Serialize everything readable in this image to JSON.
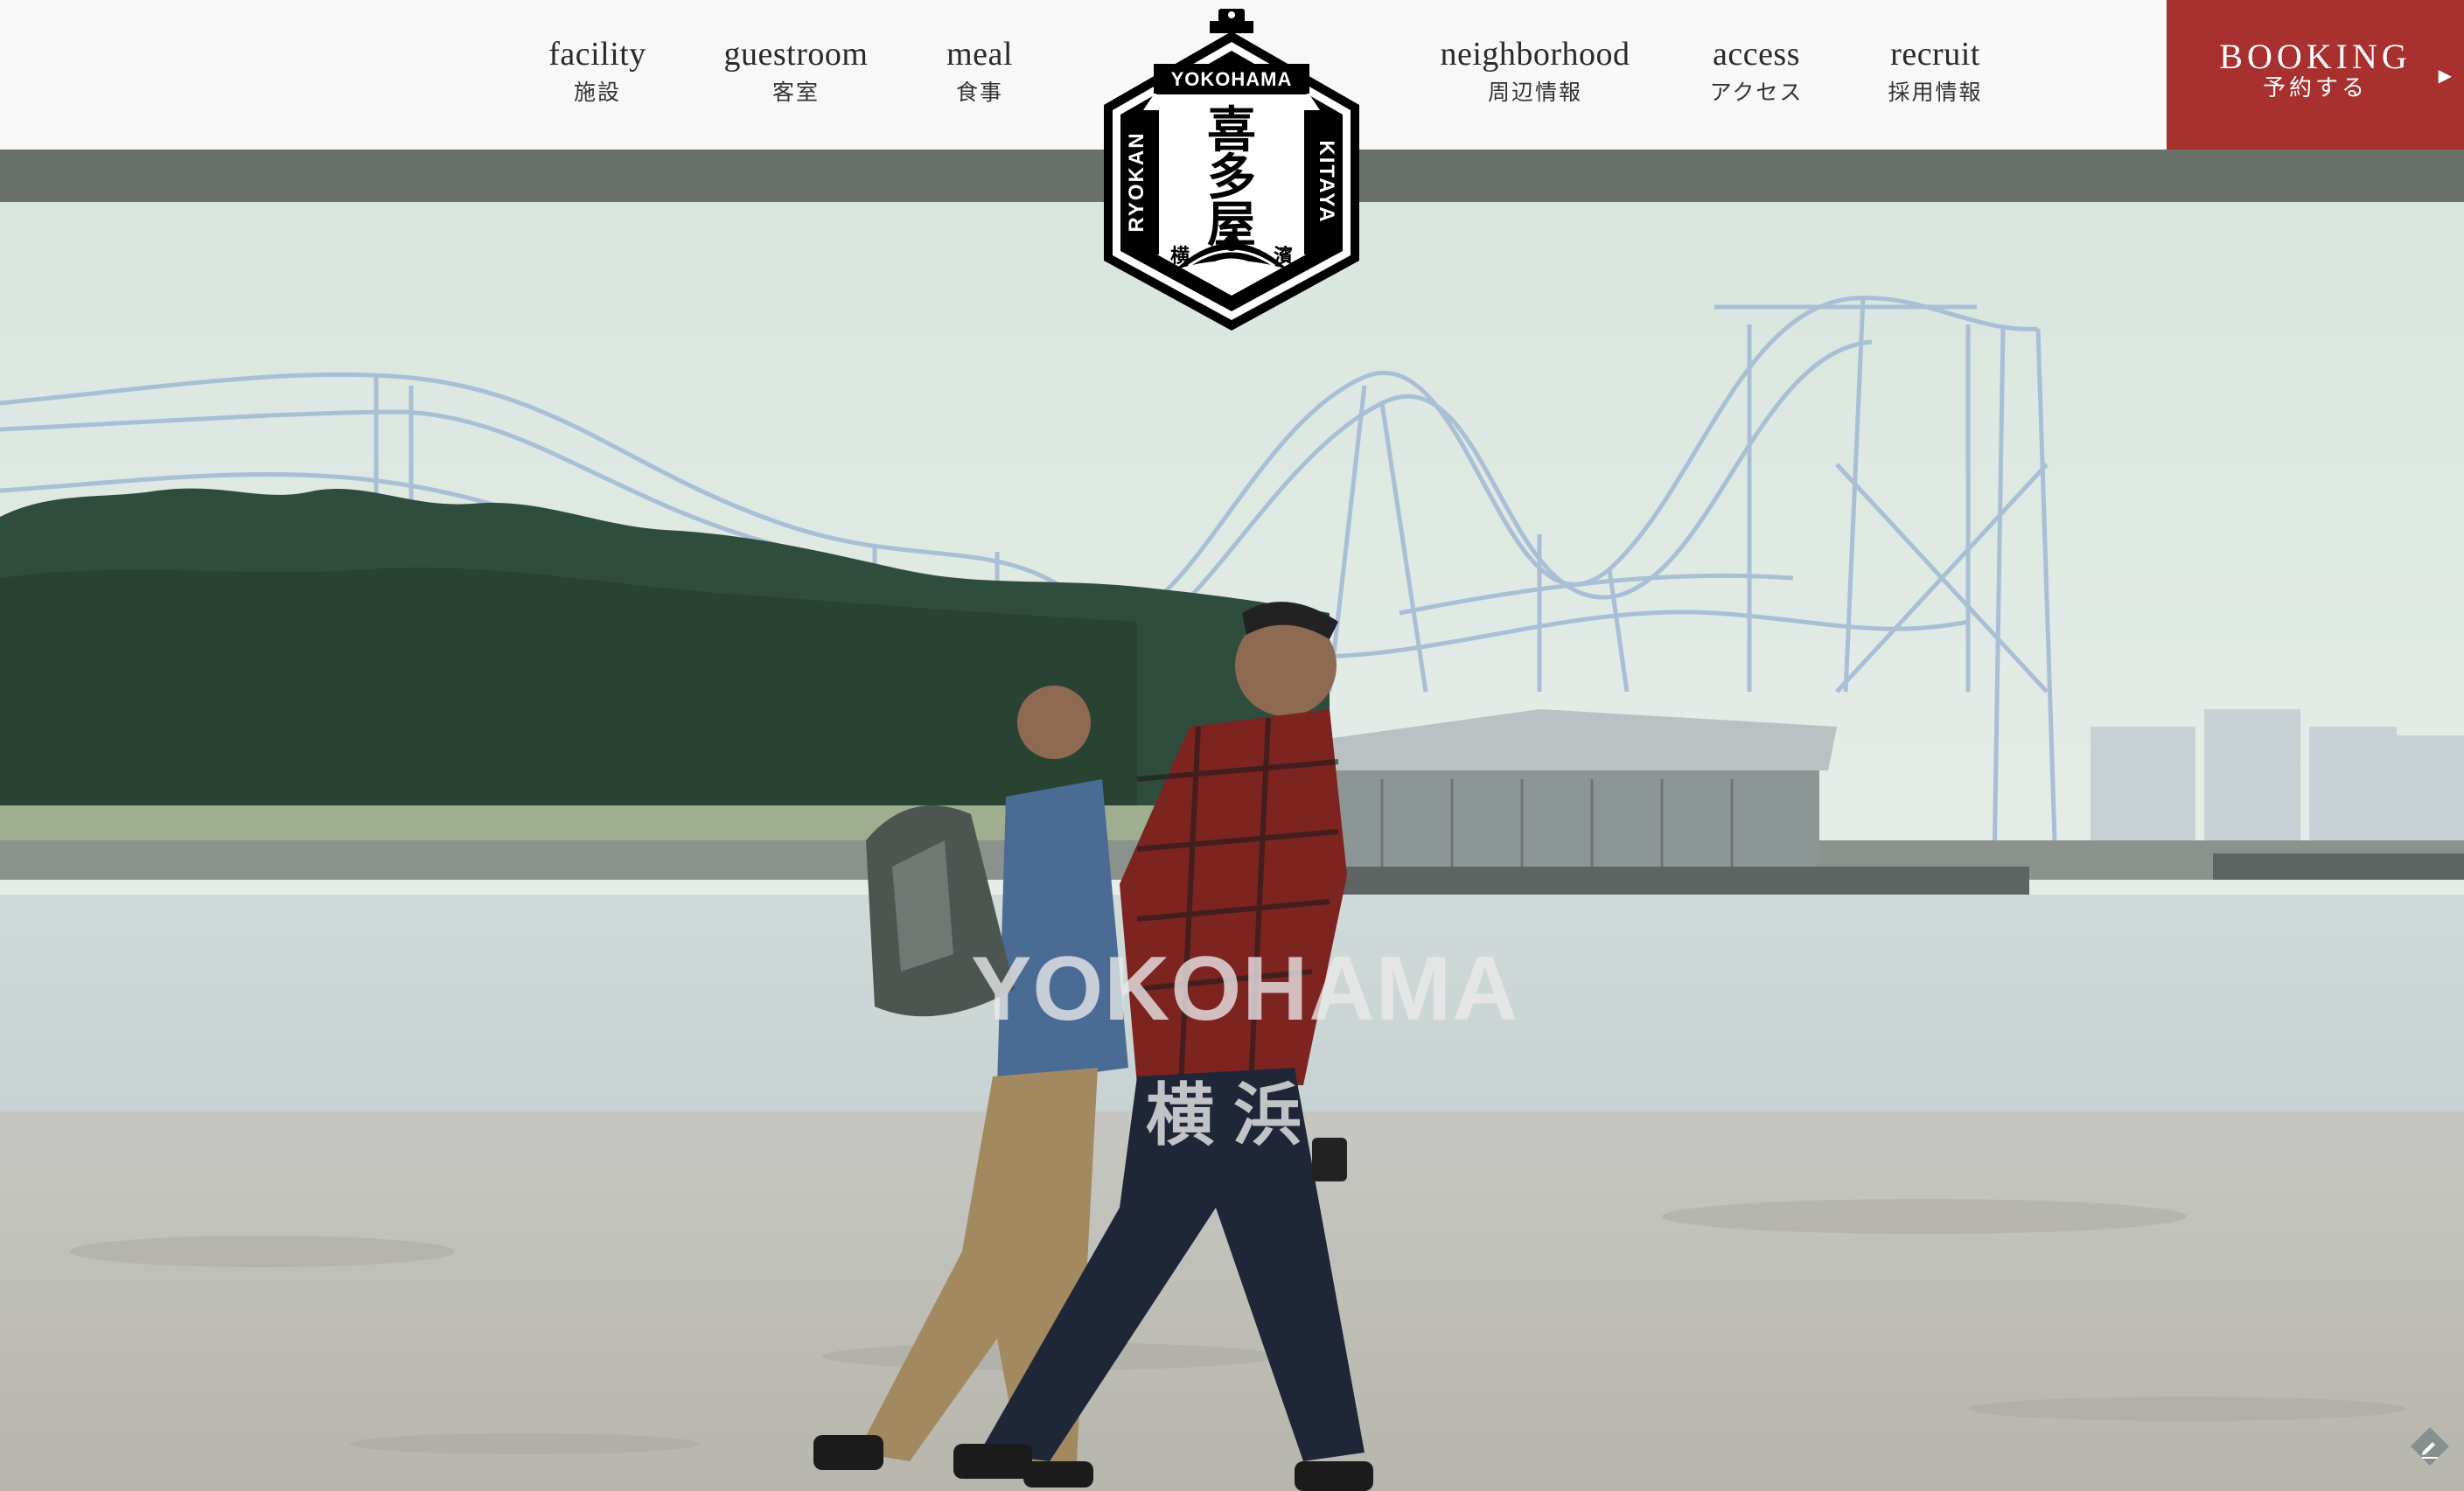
{
  "nav": {
    "items": [
      {
        "en": "facility",
        "jp": "施設"
      },
      {
        "en": "guestroom",
        "jp": "客室"
      },
      {
        "en": "meal",
        "jp": "食事"
      },
      {
        "en": "neighborhood",
        "jp": "周辺情報"
      },
      {
        "en": "access",
        "jp": "アクセス"
      },
      {
        "en": "recruit",
        "jp": "採用情報"
      }
    ]
  },
  "booking": {
    "en": "BOOKING",
    "jp": "予約する",
    "arrow": "▶"
  },
  "logo": {
    "top_text": "YOKOHAMA",
    "left_text": "RYOKAN",
    "right_text": "KITAYA",
    "kanji": [
      "喜",
      "多",
      "屋"
    ],
    "bottom_left": "横",
    "bottom_right": "濱"
  },
  "hero": {
    "title": "YOKOHAMA",
    "subtitle": "横浜"
  },
  "colors": {
    "booking": "#a8302e",
    "band": "#6a716b",
    "header": "#f8f8f8"
  },
  "icons": {
    "edit": "edit-icon"
  }
}
